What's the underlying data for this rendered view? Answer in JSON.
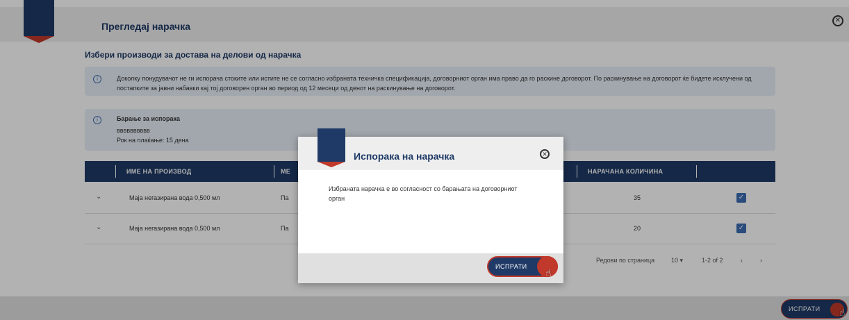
{
  "page": {
    "title": "Прегледај нарачка",
    "subtitle": "Избери производи за достава на делови од нарачка",
    "close_icon": "close-icon"
  },
  "info": {
    "text": "Доколку понудувачот не ги испорача стоките или истите не се согласно избраната техничка спецификација, договорниот орган има право да го раскине договорот. По раскинувањe на договорот ќе бидете исклучени од постапките за јавни набавки кај тој договорен орган во период од 12 месеци од денот на раскинувањe на договорот."
  },
  "request": {
    "title": "Барање за испорака",
    "line1": "вввввввввв",
    "line2": "Рок на плаќање: 15 дена"
  },
  "table": {
    "headers": [
      "ИМЕ НА ПРОИЗВОД",
      "МЕ",
      "НАРАЧАНА КОЛИЧИНА"
    ],
    "rows": [
      {
        "product": "Маја негазирана вода 0,500 мл",
        "unit": "Па",
        "qty": "35"
      },
      {
        "product": "Маја негазирана вода 0,500 мл",
        "unit": "Па",
        "qty": "20"
      }
    ]
  },
  "pagination": {
    "rows_per_page_label": "Редови по страница",
    "rows_per_page": "10",
    "range": "1-2 of 2"
  },
  "footer": {
    "send_label": "ИСПРАТИ"
  },
  "modal": {
    "title": "Испорака на нарачка",
    "body": "Избраната нарачка е во согласност со барањата на договорниот орган",
    "send_label": "ИСПРАТИ"
  },
  "colors": {
    "primary": "#1f3a66",
    "accent": "#c0392b",
    "info_bg": "#e8f0f8"
  }
}
